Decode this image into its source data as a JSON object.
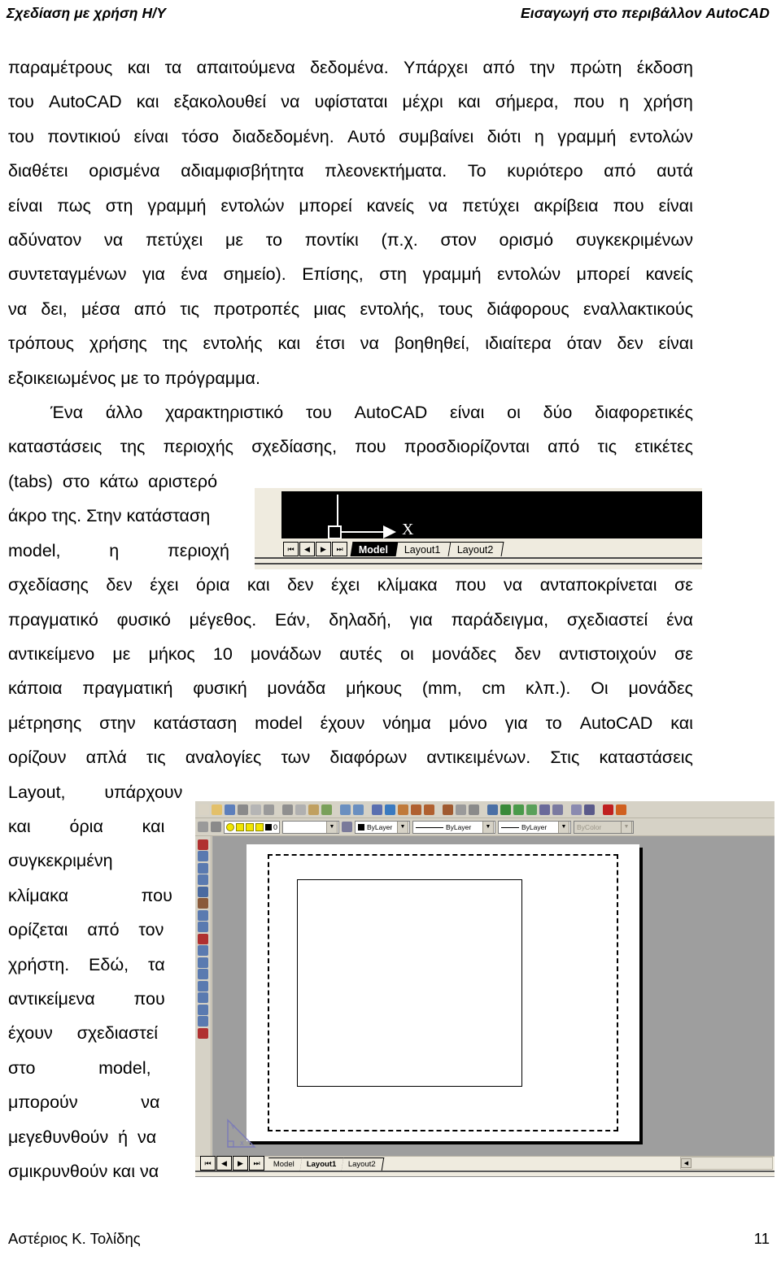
{
  "header": {
    "left": "Σχεδίαση με χρήση Η/Υ",
    "right": "Εισαγωγή στο περιβάλλον AutoCAD"
  },
  "footer": {
    "author": "Αστέριος Κ. Τολίδης",
    "page_number": "11"
  },
  "body": {
    "para1": {
      "lines": [
        [
          "παραμέτρους",
          "και",
          "τα",
          "απαιτούμενα",
          "δεδομένα.",
          "Υπάρχει",
          "από",
          "την",
          "πρώτη",
          "έκδοση"
        ],
        [
          "του",
          "AutoCAD",
          "και",
          "εξακολουθεί",
          "να",
          "υφίσταται",
          "μέχρι",
          "και",
          "σήμερα,",
          "που",
          "η",
          "χρήση"
        ],
        [
          "του",
          "ποντικιού",
          "είναι",
          "τόσο",
          "διαδεδομένη.",
          "Αυτό",
          "συμβαίνει",
          "διότι",
          "η",
          "γραμμή",
          "εντολών"
        ],
        [
          "διαθέτει",
          "ορισμένα",
          "αδιαμφισβήτητα",
          "πλεονεκτήματα.",
          "Το",
          "κυριότερο",
          "από",
          "αυτά"
        ],
        [
          "είναι",
          "πως",
          "στη",
          "γραμμή",
          "εντολών",
          "μπορεί",
          "κανείς",
          "να",
          "πετύχει",
          "ακρίβεια",
          "που",
          "είναι"
        ],
        [
          "αδύνατον",
          "να",
          "πετύχει",
          "με",
          "το",
          "ποντίκι",
          "(π.χ.",
          "στον",
          "ορισμό",
          "συγκεκριμένων"
        ],
        [
          "συντεταγμένων",
          "για",
          "ένα",
          "σημείο).",
          "Επίσης,",
          "στη",
          "γραμμή",
          "εντολών",
          "μπορεί",
          "κανείς"
        ],
        [
          "να",
          "δει,",
          "μέσα",
          "από",
          "τις",
          "προτροπές",
          "μιας",
          "εντολής,",
          "τους",
          "διάφορους",
          "εναλλακτικούς"
        ],
        [
          "τρόπους",
          "χρήσης",
          "της",
          "εντολής",
          "και",
          "έτσι",
          "να",
          "βοηθηθεί,",
          "ιδιαίτερα",
          "όταν",
          "δεν",
          "είναι"
        ]
      ],
      "last_line": "εξοικειωμένος με το πρόγραμμα."
    },
    "para2": {
      "lines": [
        [
          "Ένα",
          "άλλο",
          "χαρακτηριστικό",
          "του",
          "AutoCAD",
          "είναι",
          "οι",
          "δύο",
          "διαφορετικές"
        ],
        [
          "καταστάσεις",
          "της",
          "περιοχής",
          "σχεδίασης,",
          "που",
          "προσδιορίζονται",
          "από",
          "τις",
          "ετικέτες"
        ]
      ],
      "wrap_lines_left": [
        "(tabs)  στο  κάτω  αριστερό",
        "άκρο της. Στην κατάσταση",
        "model,          η          περιοχή"
      ],
      "lines_after_fig1": [
        [
          "σχεδίασης",
          "δεν",
          "έχει",
          "όρια",
          "και",
          "δεν",
          "έχει",
          "κλίμακα",
          "που",
          "να",
          "ανταποκρίνεται",
          "σε"
        ],
        [
          "πραγματικό",
          "φυσικό",
          "μέγεθος.",
          "Εάν,",
          "δηλαδή,",
          "για",
          "παράδειγμα,",
          "σχεδιαστεί",
          "ένα"
        ],
        [
          "αντικείμενο",
          "με",
          "μήκος",
          "10",
          "μονάδων",
          "αυτές",
          "οι",
          "μονάδες",
          "δεν",
          "αντιστοιχούν",
          "σε"
        ],
        [
          "κάποια",
          "πραγματική",
          "φυσική",
          "μονάδα",
          "μήκους",
          "(mm,",
          "cm",
          "κλπ.).",
          "Οι",
          "μονάδες"
        ],
        [
          "μέτρησης",
          "στην",
          "κατάσταση",
          "model",
          "έχουν",
          "νόημα",
          "μόνο",
          "για",
          "το",
          "AutoCAD",
          "και"
        ],
        [
          "ορίζουν",
          "απλά",
          "τις",
          "αναλογίες",
          "των",
          "διαφόρων",
          "αντικειμένων.",
          "Στις",
          "καταστάσεις"
        ]
      ],
      "wrap_lines_left2": [
        "Layout,        υπάρχουν",
        "και        όρια        και",
        "συγκεκριμένη",
        "κλίμακα               που",
        "ορίζεται    από    τον",
        "χρήστη.    Εδώ,    τα",
        "αντικείμενα        που",
        "έχουν     σχεδιαστεί",
        "στο             model,",
        "μπορούν             να",
        "μεγεθυνθούν  ή  να",
        "σμικρυνθούν και να"
      ]
    }
  },
  "figure_model": {
    "caption_role": "autocad-model-tab-strip",
    "nav_buttons": [
      "⏮",
      "◀",
      "▶",
      "⏭"
    ],
    "tabs": [
      {
        "label": "Model",
        "active": true
      },
      {
        "label": "Layout1",
        "active": false
      },
      {
        "label": "Layout2",
        "active": false
      }
    ],
    "ucs_axis_label": "X"
  },
  "figure_layout": {
    "caption_role": "autocad-layout-window",
    "toolbar_icons": [
      "new-icon",
      "open-icon",
      "save-icon",
      "print-icon",
      "print-preview-icon",
      "find-icon",
      "cut-icon",
      "copy-icon",
      "paste-icon",
      "match-properties-icon",
      "undo-icon",
      "redo-icon",
      "insert-hyperlink-icon",
      "insert-block-icon",
      "pan-realtime-icon",
      "zoom-realtime-icon",
      "zoom-window-icon",
      "zoom-previous-icon",
      "zoom-scale-icon",
      "ucs-icon",
      "named-views-icon",
      "render-icon",
      "distance-icon",
      "area-icon",
      "zoom-in-icon",
      "zoom-out-icon",
      "properties-icon",
      "design-center-icon",
      "help-icon",
      "layer-icon"
    ],
    "toolbar_colors": [
      "#d9d3c4",
      "#e3c06a",
      "#5d7fbb",
      "#8a8a8a",
      "#b5b5b5",
      "#9a9a9a",
      "#8f8f8f",
      "#b0b0b0",
      "#c0a060",
      "#7aa05a",
      "#6a8fc0",
      "#6a8fc0",
      "#5a6fb0",
      "#3a7ac0",
      "#c07a3a",
      "#b06030",
      "#b06030",
      "#a05a30",
      "#9a9a9a",
      "#8a8a8a",
      "#4a6fa5",
      "#3a8a3a",
      "#4a9a4a",
      "#5aa05a",
      "#6a6a9a",
      "#7a7aa0",
      "#8a8ab0",
      "#5a5a8a",
      "#c02020",
      "#d06020"
    ],
    "left_toolbar_icons": [
      "erase-icon",
      "copy-object-icon",
      "mirror-icon",
      "offset-icon",
      "array-icon",
      "move-icon",
      "rotate-icon",
      "scale-icon",
      "stretch-icon",
      "lengthen-icon",
      "trim-icon",
      "extend-icon",
      "break-at-point-icon",
      "break-icon",
      "chamfer-icon",
      "fillet-icon",
      "explode-icon"
    ],
    "left_toolbar_colors": [
      "#b03030",
      "#5a7ab0",
      "#5a7ab0",
      "#5a7ab0",
      "#4a6aa0",
      "#8a5a3a",
      "#5a7ab0",
      "#5a7ab0",
      "#b03030",
      "#5a7ab0",
      "#5a7ab0",
      "#5a7ab0",
      "#5a7ab0",
      "#5a7ab0",
      "#5a7ab0",
      "#5a7ab0",
      "#b03030"
    ],
    "layer_name": "0",
    "color_combo": "ByLayer",
    "linetype_combo": "ByLayer",
    "lineweight_combo": "ByLayer",
    "plotstyle_combo": "ByColor",
    "nav_buttons": [
      "⏮",
      "◀",
      "▶",
      "⏭"
    ],
    "tabs": [
      {
        "label": "Model",
        "active": false
      },
      {
        "label": "Layout1",
        "active": true
      },
      {
        "label": "Layout2",
        "active": false
      }
    ],
    "canvas_bg": "#9e9e9e",
    "sheet_bg": "#ffffff"
  }
}
